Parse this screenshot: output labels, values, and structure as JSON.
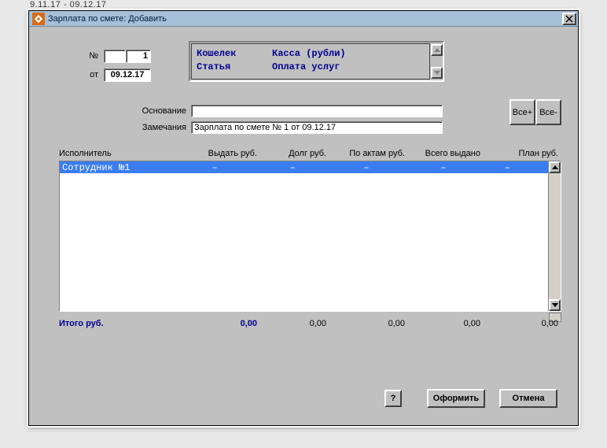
{
  "stray_text": "9.11.17 - 09.12.17",
  "window": {
    "title": "Зарплата по смете: Добавить"
  },
  "header": {
    "no_label": "№",
    "no_prefix": "",
    "no_value": "1",
    "date_label": "от",
    "date_value": "09.12.17",
    "group": {
      "wallet_key": "Кошелек",
      "wallet_val": "Касса (рубли)",
      "article_key": "Статья",
      "article_val": "Оплата услуг"
    },
    "basis_label": "Основание",
    "basis_value": "",
    "notes_label": "Замечания",
    "notes_value": "Зарплата по смете № 1 от 09.12.17",
    "all_plus": "Все+",
    "all_minus": "Все-"
  },
  "grid": {
    "columns": [
      "Исполнитель",
      "Выдать руб.",
      "Долг руб.",
      "По актам руб.",
      "Всего выдано",
      "План руб."
    ],
    "row": {
      "name": "Сотрудник №1",
      "give": "–",
      "debt": "–",
      "acts": "–",
      "total": "–",
      "plan": "–"
    }
  },
  "totals": {
    "label": "Итого руб.",
    "give": "0,00",
    "debt": "0,00",
    "acts": "0,00",
    "total": "0,00",
    "plan": "0,00"
  },
  "buttons": {
    "help": "?",
    "submit": "Оформить",
    "cancel": "Отмена"
  }
}
